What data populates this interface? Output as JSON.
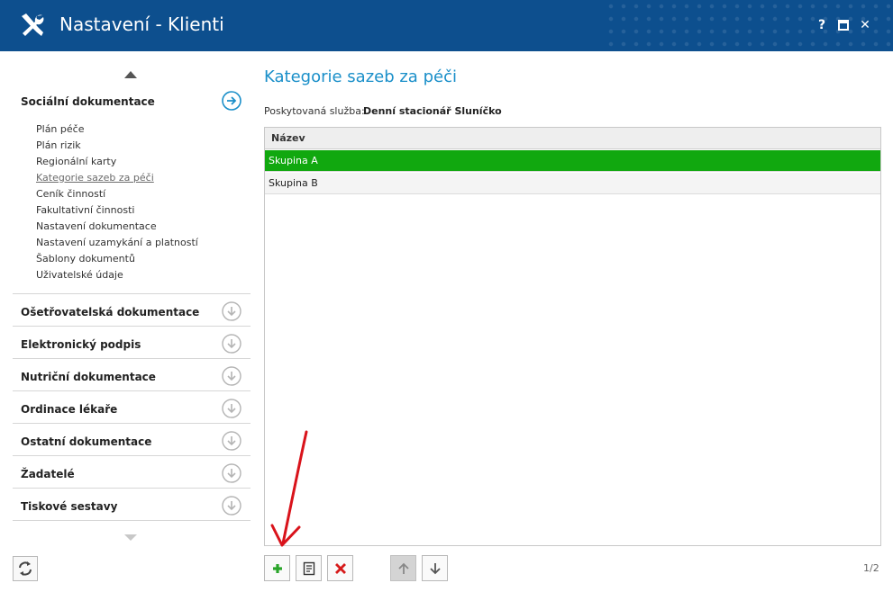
{
  "window": {
    "title": "Nastavení - Klienti",
    "help_label": "?",
    "maximize_icon": "square-icon",
    "close_label": "✕"
  },
  "sidebar": {
    "expanded_section": {
      "label": "Sociální dokumentace",
      "items": [
        {
          "label": "Plán péče",
          "active": false
        },
        {
          "label": "Plán rizik",
          "active": false
        },
        {
          "label": "Regionální karty",
          "active": false
        },
        {
          "label": "Kategorie sazeb za péči",
          "active": true
        },
        {
          "label": "Ceník činností",
          "active": false
        },
        {
          "label": "Fakultativní činnosti",
          "active": false
        },
        {
          "label": "Nastavení dokumentace",
          "active": false
        },
        {
          "label": "Nastavení uzamykání a platností",
          "active": false
        },
        {
          "label": "Šablony dokumentů",
          "active": false
        },
        {
          "label": "Uživatelské údaje",
          "active": false
        }
      ]
    },
    "sections": [
      {
        "label": "Ošetřovatelská dokumentace"
      },
      {
        "label": "Elektronický podpis"
      },
      {
        "label": "Nutriční dokumentace"
      },
      {
        "label": "Ordinace lékaře"
      },
      {
        "label": "Ostatní dokumentace"
      },
      {
        "label": "Žadatelé"
      },
      {
        "label": "Tiskové sestavy"
      }
    ]
  },
  "main": {
    "title": "Kategorie sazeb za péči",
    "service_label": "Poskytovaná služba:",
    "service_value": "Denní stacionář Sluníčko",
    "table": {
      "columns": [
        "Název"
      ],
      "rows": [
        {
          "name": "Skupina A",
          "selected": true
        },
        {
          "name": "Skupina B",
          "selected": false
        }
      ]
    },
    "toolbar": {
      "add": "add-icon",
      "edit": "edit-icon",
      "delete": "delete-icon",
      "move_up": "arrow-up-icon",
      "move_down": "arrow-down-icon"
    },
    "pager": "1/2"
  },
  "colors": {
    "titlebar": "#0d4f8e",
    "accent": "#1a8fc9",
    "selected_row": "#11a80f",
    "annotation": "#d9131b"
  }
}
